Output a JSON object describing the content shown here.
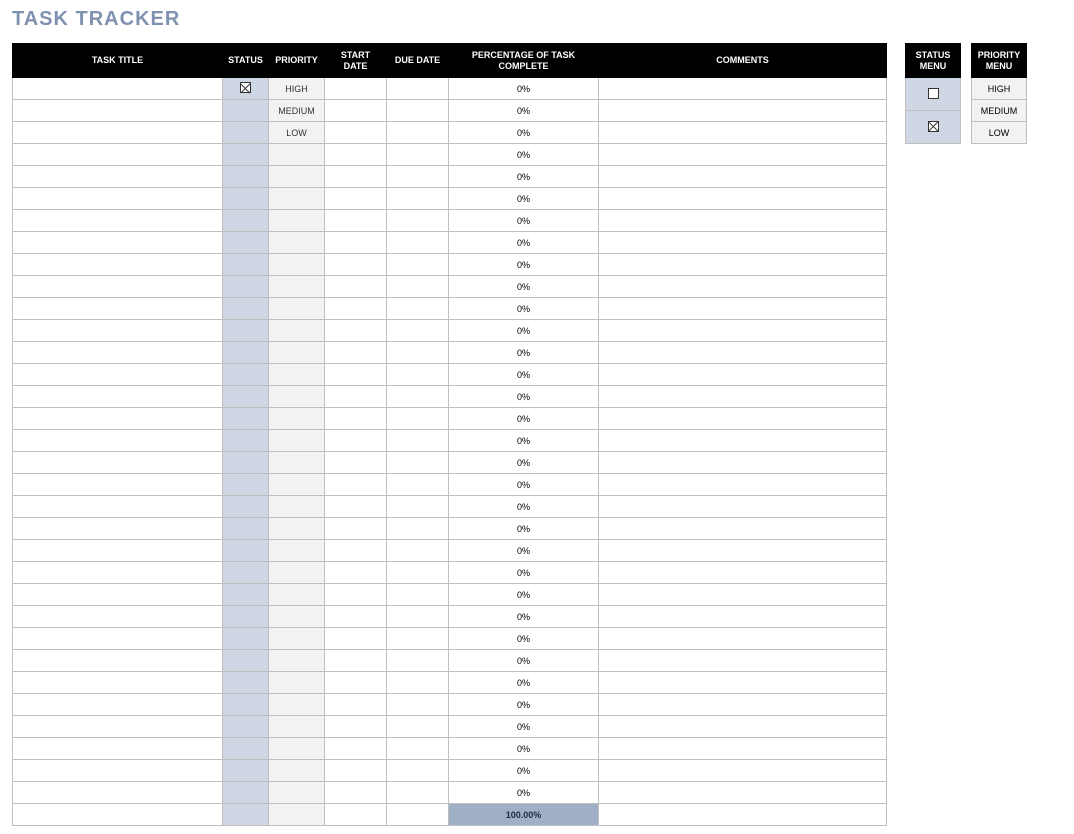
{
  "title": "TASK TRACKER",
  "columns": {
    "task_title": "TASK  TITLE",
    "status": "STATUS",
    "priority": "PRIORITY",
    "start_date": "START  DATE",
    "due_date": "DUE  DATE",
    "pct_complete": "PERCENTAGE  OF  TASK COMPLETE",
    "comments": "COMMENTS"
  },
  "rows": [
    {
      "task_title": "",
      "status_checked": true,
      "priority": "HIGH",
      "start_date": "",
      "due_date": "",
      "pct": "0%",
      "comments": ""
    },
    {
      "task_title": "",
      "status_checked": false,
      "priority": "MEDIUM",
      "start_date": "",
      "due_date": "",
      "pct": "0%",
      "comments": ""
    },
    {
      "task_title": "",
      "status_checked": false,
      "priority": "LOW",
      "start_date": "",
      "due_date": "",
      "pct": "0%",
      "comments": ""
    },
    {
      "task_title": "",
      "status_checked": false,
      "priority": "",
      "start_date": "",
      "due_date": "",
      "pct": "0%",
      "comments": ""
    },
    {
      "task_title": "",
      "status_checked": false,
      "priority": "",
      "start_date": "",
      "due_date": "",
      "pct": "0%",
      "comments": ""
    },
    {
      "task_title": "",
      "status_checked": false,
      "priority": "",
      "start_date": "",
      "due_date": "",
      "pct": "0%",
      "comments": ""
    },
    {
      "task_title": "",
      "status_checked": false,
      "priority": "",
      "start_date": "",
      "due_date": "",
      "pct": "0%",
      "comments": ""
    },
    {
      "task_title": "",
      "status_checked": false,
      "priority": "",
      "start_date": "",
      "due_date": "",
      "pct": "0%",
      "comments": ""
    },
    {
      "task_title": "",
      "status_checked": false,
      "priority": "",
      "start_date": "",
      "due_date": "",
      "pct": "0%",
      "comments": ""
    },
    {
      "task_title": "",
      "status_checked": false,
      "priority": "",
      "start_date": "",
      "due_date": "",
      "pct": "0%",
      "comments": ""
    },
    {
      "task_title": "",
      "status_checked": false,
      "priority": "",
      "start_date": "",
      "due_date": "",
      "pct": "0%",
      "comments": ""
    },
    {
      "task_title": "",
      "status_checked": false,
      "priority": "",
      "start_date": "",
      "due_date": "",
      "pct": "0%",
      "comments": ""
    },
    {
      "task_title": "",
      "status_checked": false,
      "priority": "",
      "start_date": "",
      "due_date": "",
      "pct": "0%",
      "comments": ""
    },
    {
      "task_title": "",
      "status_checked": false,
      "priority": "",
      "start_date": "",
      "due_date": "",
      "pct": "0%",
      "comments": ""
    },
    {
      "task_title": "",
      "status_checked": false,
      "priority": "",
      "start_date": "",
      "due_date": "",
      "pct": "0%",
      "comments": ""
    },
    {
      "task_title": "",
      "status_checked": false,
      "priority": "",
      "start_date": "",
      "due_date": "",
      "pct": "0%",
      "comments": ""
    },
    {
      "task_title": "",
      "status_checked": false,
      "priority": "",
      "start_date": "",
      "due_date": "",
      "pct": "0%",
      "comments": ""
    },
    {
      "task_title": "",
      "status_checked": false,
      "priority": "",
      "start_date": "",
      "due_date": "",
      "pct": "0%",
      "comments": ""
    },
    {
      "task_title": "",
      "status_checked": false,
      "priority": "",
      "start_date": "",
      "due_date": "",
      "pct": "0%",
      "comments": ""
    },
    {
      "task_title": "",
      "status_checked": false,
      "priority": "",
      "start_date": "",
      "due_date": "",
      "pct": "0%",
      "comments": ""
    },
    {
      "task_title": "",
      "status_checked": false,
      "priority": "",
      "start_date": "",
      "due_date": "",
      "pct": "0%",
      "comments": ""
    },
    {
      "task_title": "",
      "status_checked": false,
      "priority": "",
      "start_date": "",
      "due_date": "",
      "pct": "0%",
      "comments": ""
    },
    {
      "task_title": "",
      "status_checked": false,
      "priority": "",
      "start_date": "",
      "due_date": "",
      "pct": "0%",
      "comments": ""
    },
    {
      "task_title": "",
      "status_checked": false,
      "priority": "",
      "start_date": "",
      "due_date": "",
      "pct": "0%",
      "comments": ""
    },
    {
      "task_title": "",
      "status_checked": false,
      "priority": "",
      "start_date": "",
      "due_date": "",
      "pct": "0%",
      "comments": ""
    },
    {
      "task_title": "",
      "status_checked": false,
      "priority": "",
      "start_date": "",
      "due_date": "",
      "pct": "0%",
      "comments": ""
    },
    {
      "task_title": "",
      "status_checked": false,
      "priority": "",
      "start_date": "",
      "due_date": "",
      "pct": "0%",
      "comments": ""
    },
    {
      "task_title": "",
      "status_checked": false,
      "priority": "",
      "start_date": "",
      "due_date": "",
      "pct": "0%",
      "comments": ""
    },
    {
      "task_title": "",
      "status_checked": false,
      "priority": "",
      "start_date": "",
      "due_date": "",
      "pct": "0%",
      "comments": ""
    },
    {
      "task_title": "",
      "status_checked": false,
      "priority": "",
      "start_date": "",
      "due_date": "",
      "pct": "0%",
      "comments": ""
    },
    {
      "task_title": "",
      "status_checked": false,
      "priority": "",
      "start_date": "",
      "due_date": "",
      "pct": "0%",
      "comments": ""
    },
    {
      "task_title": "",
      "status_checked": false,
      "priority": "",
      "start_date": "",
      "due_date": "",
      "pct": "0%",
      "comments": ""
    },
    {
      "task_title": "",
      "status_checked": false,
      "priority": "",
      "start_date": "",
      "due_date": "",
      "pct": "0%",
      "comments": ""
    }
  ],
  "total_pct": "100.00%",
  "status_menu": {
    "header": "STATUS MENU",
    "items": [
      {
        "checked": false
      },
      {
        "checked": true
      }
    ]
  },
  "priority_menu": {
    "header": "PRIORITY MENU",
    "items": [
      "HIGH",
      "MEDIUM",
      "LOW"
    ]
  }
}
